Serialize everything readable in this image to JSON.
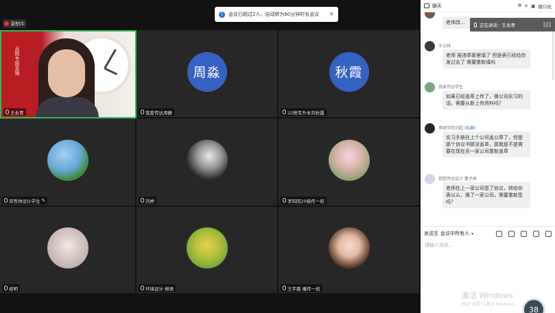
{
  "recording": {
    "label": "录制中"
  },
  "notice": {
    "text": "会议已超过2人，自动转为60分钟时长会议",
    "close": "×"
  },
  "tiles": [
    {
      "label": "王永青",
      "type": "camera",
      "speaking": true
    },
    {
      "label": "我爱传达周静",
      "type": "blank"
    },
    {
      "label": "22税专升本刘秋霞",
      "type": "name",
      "name_text": "秋霞"
    },
    {
      "label": "邓哲帅设计学生",
      "type": "avatar",
      "pencil": true
    },
    {
      "label": "刘婷",
      "type": "avatar"
    },
    {
      "label": "李知阳20级传一班",
      "type": "avatar"
    },
    {
      "label": "胡明",
      "type": "avatar"
    },
    {
      "label": "环境设计 榕语",
      "type": "avatar"
    },
    {
      "label": "王宇晨 播传一班",
      "type": "avatar"
    }
  ],
  "name_circle_2": "周淼",
  "camera": {
    "banner": "品牌专题直播"
  },
  "chat": {
    "title": "聊天",
    "float_label": "窗口化",
    "speaking_label": "正在讲话：王永青",
    "messages": [
      {
        "name": "",
        "sub": "",
        "text": "老师改…"
      },
      {
        "name": "王以林",
        "sub": "",
        "text": "老师 报违章那里填了 但是表已经给你发过去了 需要重新填吗"
      },
      {
        "name": "我爱传达学生",
        "sub": "",
        "text": "如果已经盖章上传了，换公司实习的话，需要从新上传资料吗？"
      },
      {
        "name": "李刚学院刘超",
        "sub": "(私聊)",
        "text": "实习手册在上个公司盖公章了，但是那个协议书那没盖章，那我是不是需要在现在另一家公司重新盖章"
      },
      {
        "name": "视觉传达设计 曹子婷",
        "sub": "",
        "text": "老师在上一家公司签了协议，转给你表以么，换了一家公司，需要重新签吗？"
      }
    ],
    "send_to_label": "发送至",
    "send_to_target": "会议中所有人",
    "placeholder": "请输入消息…",
    "watermark_line1": "激活 Windows",
    "watermark_line2": "转到\"设置\"以激活 Windows。",
    "count": "38"
  }
}
